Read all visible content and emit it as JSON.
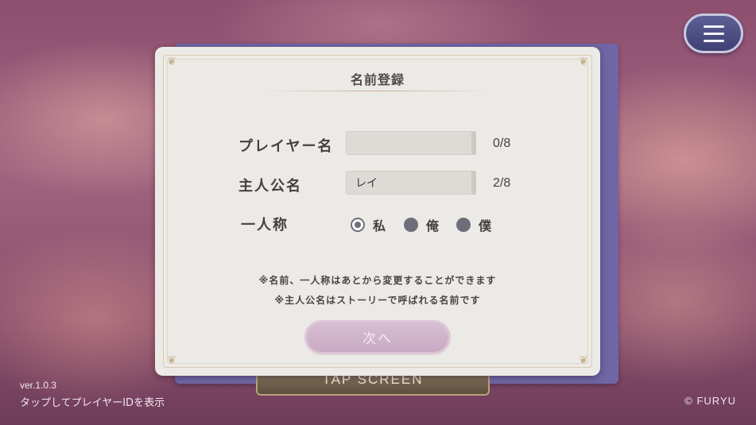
{
  "background": {
    "tap_screen_text": "TAP SCREEN"
  },
  "dialog": {
    "title": "名前登録",
    "player_name": {
      "label": "プレイヤー名",
      "value": "",
      "counter": "0/8"
    },
    "hero_name": {
      "label": "主人公名",
      "value": "レイ",
      "counter": "2/8"
    },
    "pronoun": {
      "label": "一人称",
      "options": [
        {
          "label": "私",
          "selected": true
        },
        {
          "label": "俺",
          "selected": false
        },
        {
          "label": "僕",
          "selected": false
        }
      ]
    },
    "notes": [
      "※名前、一人称はあとから変更することができます",
      "※主人公名はストーリーで呼ばれる名前です"
    ],
    "next_label": "次へ"
  },
  "menu": {
    "icon": "hamburger-menu-icon"
  },
  "footer": {
    "version": "ver.1.0.3",
    "tap_id_text": "タップしてプレイヤーIDを表示",
    "copyright": "© FURYU"
  }
}
